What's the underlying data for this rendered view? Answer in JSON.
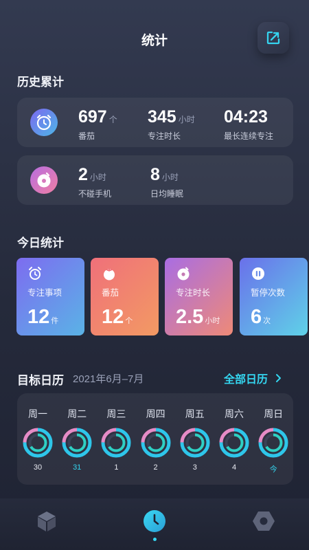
{
  "header": {
    "title": "统计",
    "share_icon": "share-icon"
  },
  "history": {
    "title": "历史累计",
    "card1": {
      "icon": "alarm-clock-icon",
      "stats": [
        {
          "value": "697",
          "unit": "个",
          "label": "番茄"
        },
        {
          "value": "345",
          "unit": "小时",
          "label": "专注时长"
        },
        {
          "value": "04:23",
          "unit": "",
          "label": "最长连续专注"
        }
      ]
    },
    "card2": {
      "icon": "phone-disc-icon",
      "stats": [
        {
          "value": "2",
          "unit": "小时",
          "label": "不碰手机"
        },
        {
          "value": "8",
          "unit": "小时",
          "label": "日均睡眠"
        }
      ]
    }
  },
  "today": {
    "title": "今日统计",
    "tiles": [
      {
        "label": "专注事项",
        "value": "12",
        "unit": "件",
        "icon": "alarm-icon",
        "color_from": "#7d6cf0",
        "color_to": "#5ab3e6"
      },
      {
        "label": "番茄",
        "value": "12",
        "unit": "个",
        "icon": "tomato-icon",
        "color_from": "#f0707a",
        "color_to": "#f29a63"
      },
      {
        "label": "专注时长",
        "value": "2.5",
        "unit": "小时",
        "icon": "disc-icon",
        "color_from": "#a96de3",
        "color_to": "#ee8a77"
      },
      {
        "label": "暂停次数",
        "value": "6",
        "unit": "次",
        "icon": "pause-icon",
        "color_from": "#6a70ea",
        "color_to": "#5fd2e8"
      }
    ]
  },
  "calendar": {
    "title": "目标日历",
    "range": "2021年6月–7月",
    "all_link": "全部日历",
    "chevron": "chevron-right-icon",
    "days": [
      {
        "weekday": "周一",
        "date": "30",
        "highlight": false
      },
      {
        "weekday": "周二",
        "date": "31",
        "highlight": true
      },
      {
        "weekday": "周三",
        "date": "1",
        "highlight": false
      },
      {
        "weekday": "周四",
        "date": "2",
        "highlight": false
      },
      {
        "weekday": "周五",
        "date": "3",
        "highlight": false
      },
      {
        "weekday": "周六",
        "date": "4",
        "highlight": false
      },
      {
        "weekday": "周日",
        "date": "今",
        "highlight": true
      }
    ]
  },
  "nav": {
    "items": [
      {
        "icon": "cube-icon",
        "active": false
      },
      {
        "icon": "clock-icon",
        "active": true
      },
      {
        "icon": "settings-hex-icon",
        "active": false
      }
    ]
  },
  "colors": {
    "accent": "#34d6f0",
    "muted": "#9aa1b8"
  }
}
